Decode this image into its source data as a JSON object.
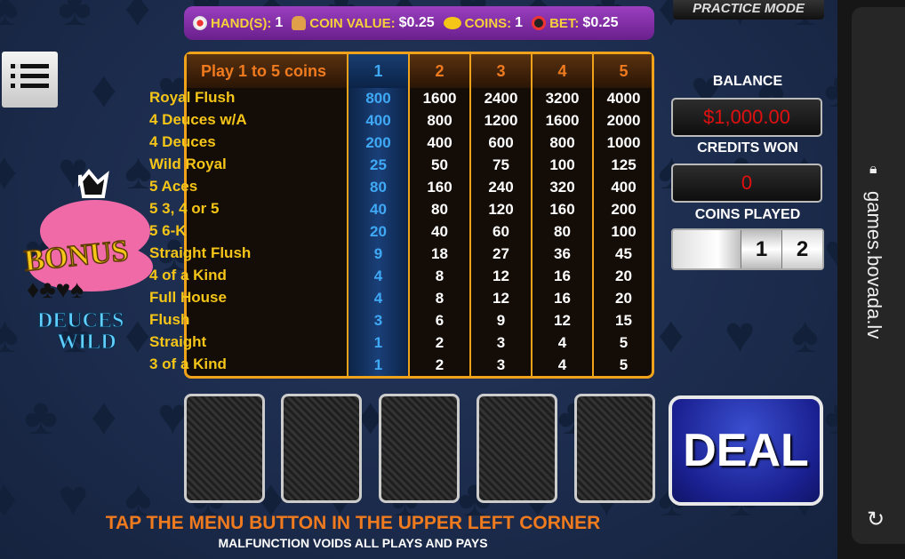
{
  "header": {
    "hands_label": "HAND(S):",
    "hands": "1",
    "coin_value_label": "COIN VALUE:",
    "coin_value": "$0.25",
    "coins_label": "COINS:",
    "coins": "1",
    "bet_label": "BET:",
    "bet": "$0.25",
    "practice_mode": "PRACTICE MODE"
  },
  "logo": {
    "text1": "BONUS",
    "text2": "DEUCES",
    "text3": "WILD"
  },
  "paytable": {
    "play_label": "Play 1 to 5 coins",
    "columns": [
      "1",
      "2",
      "3",
      "4",
      "5"
    ],
    "selected_column": 1,
    "hands": [
      "Royal Flush",
      "4 Deuces w/A",
      "4 Deuces",
      "Wild Royal",
      "5 Aces",
      "5 3, 4 or 5",
      "5 6-K",
      "Straight Flush",
      "4 of a Kind",
      "Full House",
      "Flush",
      "Straight",
      "3 of a Kind"
    ],
    "payouts": [
      [
        "800",
        "400",
        "200",
        "25",
        "80",
        "40",
        "20",
        "9",
        "4",
        "4",
        "3",
        "1",
        "1"
      ],
      [
        "1600",
        "800",
        "400",
        "50",
        "160",
        "80",
        "40",
        "18",
        "8",
        "8",
        "6",
        "2",
        "2"
      ],
      [
        "2400",
        "1200",
        "600",
        "75",
        "240",
        "120",
        "60",
        "27",
        "12",
        "12",
        "9",
        "3",
        "3"
      ],
      [
        "3200",
        "1600",
        "800",
        "100",
        "320",
        "160",
        "80",
        "36",
        "16",
        "16",
        "12",
        "4",
        "4"
      ],
      [
        "4000",
        "2000",
        "1000",
        "125",
        "400",
        "200",
        "100",
        "45",
        "20",
        "20",
        "15",
        "5",
        "5"
      ]
    ]
  },
  "balance": {
    "label": "BALANCE",
    "value": "$1,000.00"
  },
  "credits_won": {
    "label": "CREDITS WON",
    "value": "0"
  },
  "coins_played": {
    "label": "COINS PLAYED",
    "digits": [
      "1",
      "2"
    ]
  },
  "deal_label": "DEAL",
  "footer": {
    "tip": "TAP THE MENU BUTTON IN THE UPPER LEFT CORNER",
    "disclaimer": "MALFUNCTION VOIDS ALL PLAYS AND PAYS"
  },
  "browser": {
    "url": "games.bovada.lv"
  },
  "colors": {
    "background": "#1b2b4d",
    "accent_orange": "#f0a21a",
    "selected_blue": "#3fa9f5",
    "hand_yellow": "#f5c518",
    "meter_red": "#e01010",
    "deal_blue": "#1a2090"
  }
}
